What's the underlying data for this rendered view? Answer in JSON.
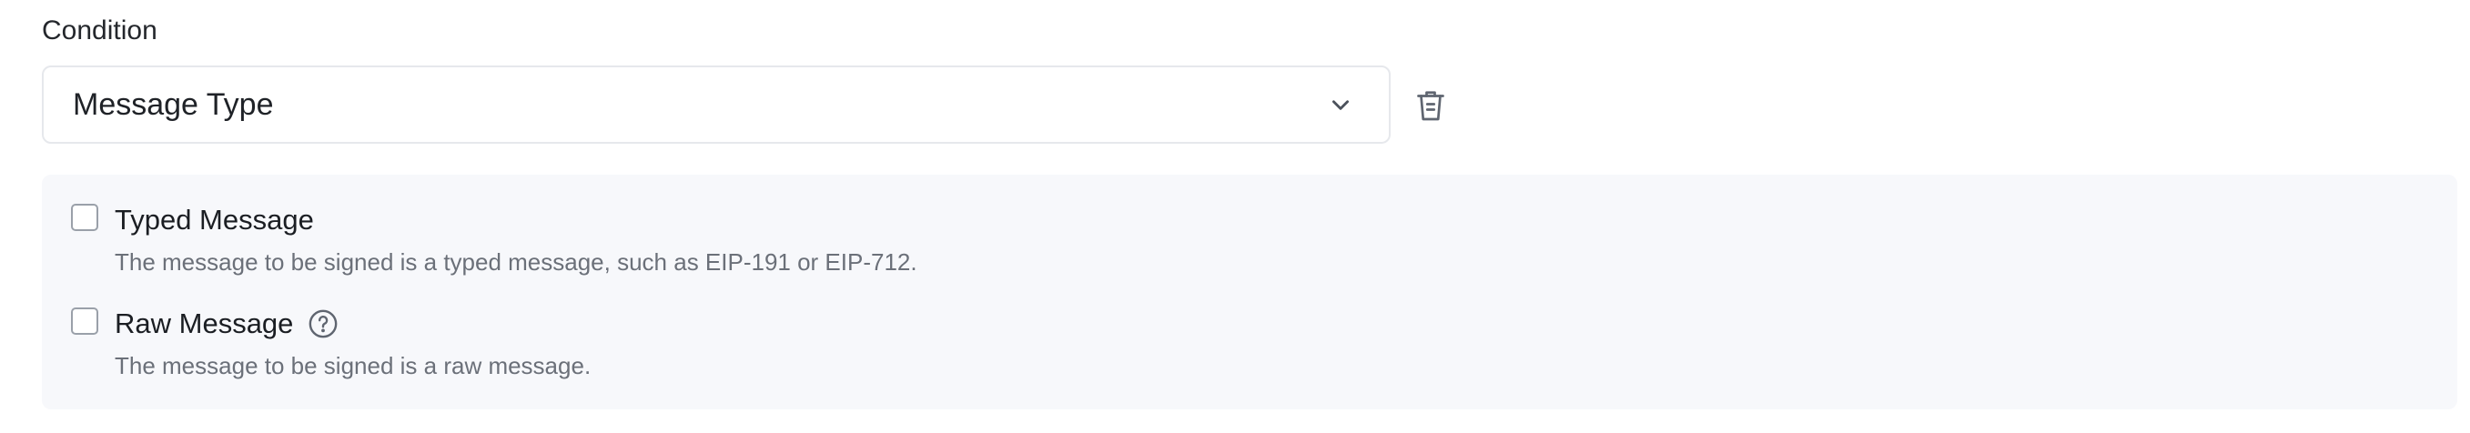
{
  "condition": {
    "label": "Condition",
    "select": {
      "value": "Message Type",
      "icon": "chevron-down-icon"
    },
    "delete_icon": "trash-icon"
  },
  "options": [
    {
      "title": "Typed Message",
      "description": "The message to be signed is a typed message, such as EIP-191 or EIP-712.",
      "checked": false
    },
    {
      "title": "Raw Message",
      "description": "The message to be signed is a raw message.",
      "checked": false,
      "help_icon": "help-circle-icon"
    }
  ],
  "colors": {
    "panel_background": "#f7f8fb",
    "border": "#e6e8ec",
    "icon": "#5f6570",
    "muted_text": "#6b7079"
  }
}
